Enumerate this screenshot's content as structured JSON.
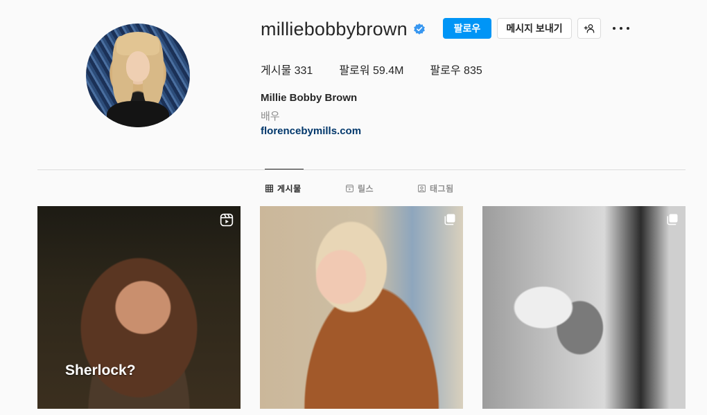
{
  "profile": {
    "username": "milliebobbybrown",
    "verified": true,
    "full_name": "Millie Bobby Brown",
    "category": "배우",
    "link": "florencebymills.com"
  },
  "actions": {
    "follow_label": "팔로우",
    "message_label": "메시지 보내기",
    "suggest_icon": "add-person-icon",
    "more_icon": "more-dots-icon"
  },
  "stats": [
    {
      "label": "게시물",
      "value": "331"
    },
    {
      "label": "팔로워",
      "value": "59.4M"
    },
    {
      "label": "팔로우",
      "value": "835"
    }
  ],
  "tabs": [
    {
      "label": "게시물",
      "icon": "grid-icon",
      "active": true
    },
    {
      "label": "릴스",
      "icon": "reels-icon",
      "active": false
    },
    {
      "label": "태그됨",
      "icon": "tagged-icon",
      "active": false
    }
  ],
  "posts": [
    {
      "type": "reel",
      "caption": "Sherlock?"
    },
    {
      "type": "carousel"
    },
    {
      "type": "carousel"
    }
  ],
  "colors": {
    "accent": "#0095f6",
    "verified": "#3897f0",
    "link": "#00376b",
    "secondary_text": "#8e8e8e",
    "background": "#fafafa"
  }
}
